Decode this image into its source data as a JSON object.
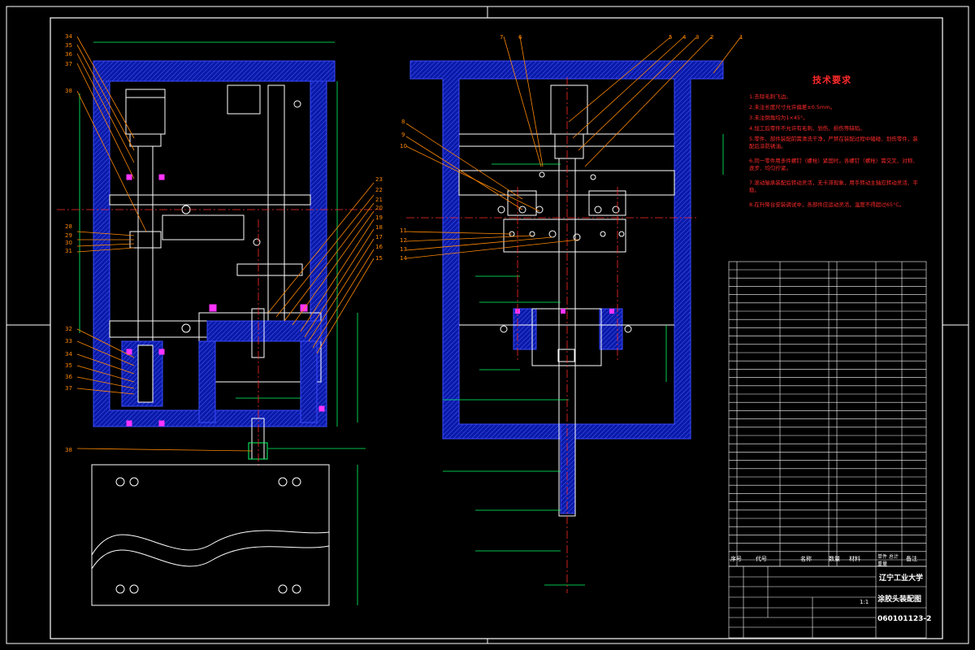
{
  "drawing": {
    "tech_requirements": {
      "title": "技术要求",
      "items": [
        "1.去除毛刺飞边。",
        "2.未注长度尺寸允许偏差±0.5mm。",
        "3.未注倒角均为1×45°。",
        "4.加工后零件不允许有毛刺、划伤、损伤等缺陷。",
        "5.零件、部件装配前需清洗干净，严禁在装配过程中磕碰、划伤零件，装配后涂防锈油。",
        "6.同一零件用多件螺钉（螺栓）紧固时，各螺钉（螺栓）需交叉、对称、逐步、均匀拧紧。",
        "7.滚动轴承装配后转动灵活，无卡滞现象，用手转动主轴应转动灵活、平稳。",
        "8.在升降台安装调试中，各部件应运动灵活，温度不得超过65°C。"
      ]
    },
    "title_block": {
      "school": "辽宁工业大学",
      "drawing_name": "涂胶头装配图",
      "drawing_number": "060101123-2",
      "scale": "1:1",
      "header_cols": [
        "序号",
        "代号",
        "名称",
        "数量",
        "材料",
        "单件 总计 重量",
        "备注"
      ]
    },
    "left_callouts": [
      "34",
      "35",
      "36",
      "37",
      "38",
      "28",
      "29",
      "30",
      "31",
      "32",
      "33",
      "34",
      "35",
      "36",
      "37",
      "38"
    ],
    "right_callouts_top": [
      "7",
      "6",
      "5",
      "4",
      "3",
      "2",
      "1"
    ],
    "right_callouts_left": [
      "8",
      "9",
      "10",
      "11",
      "12",
      "13",
      "14"
    ],
    "middle_callouts": [
      "23",
      "22",
      "21",
      "20",
      "19",
      "18",
      "17",
      "16",
      "15"
    ]
  }
}
